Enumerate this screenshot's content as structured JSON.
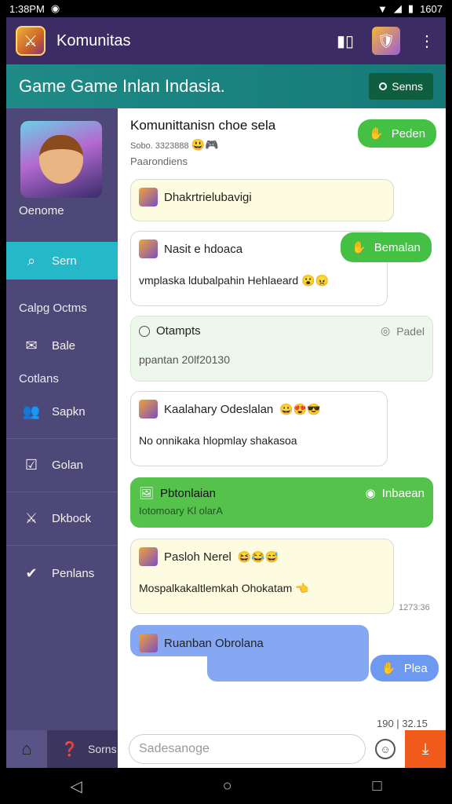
{
  "status_bar": {
    "time": "1:38PM",
    "battery": "1607"
  },
  "app": {
    "title": "Komunitas"
  },
  "banner": {
    "title": "Game Game Inlan Indasia.",
    "button_label": "Senns"
  },
  "sidebar": {
    "profile_name": "Oenome",
    "active_item": "Sern",
    "section1": "Calpg Octms",
    "item_bale": "Bale",
    "section2": "Cotlans",
    "item_sapkn": "Sapkn",
    "item_golan": "Golan",
    "item_dkbock": "Dkbock",
    "item_penlans": "Penlans",
    "bottom_label": "Sorns"
  },
  "chat": {
    "title": "Komunittanisn choe sela",
    "subtitle": "Sobo. 3323888",
    "section": "Paarondiens",
    "pill_top": "Peden",
    "msg1": {
      "text": "Dhakrtrielubavigi"
    },
    "msg2": {
      "title": "Nasit e hdoaca",
      "body": "vmplaska ldubalpahin Hehlaeard"
    },
    "pill_bemalan": "Bemalan",
    "msg3": {
      "title": "Otampts",
      "action": "Padel",
      "body": "ppantan 20lf20130"
    },
    "msg4": {
      "title": "Kaalahary Odeslalan",
      "body": "No onnikaka hlopmlay shakasoa"
    },
    "msg5": {
      "title": "Pbtonlaian",
      "sub": "Iotomoary Kl olarA",
      "action": "Inbaean"
    },
    "msg6": {
      "title": "Pasloh Nerel",
      "body": "Mospalkakaltlemkah Ohokatam",
      "time": "1273:36"
    },
    "msg7": {
      "title": "Ruanban Obrolana"
    },
    "pill_plea": "Plea",
    "time_bottom": "190 | 32.15"
  },
  "input": {
    "placeholder": "Sadesanoge"
  }
}
